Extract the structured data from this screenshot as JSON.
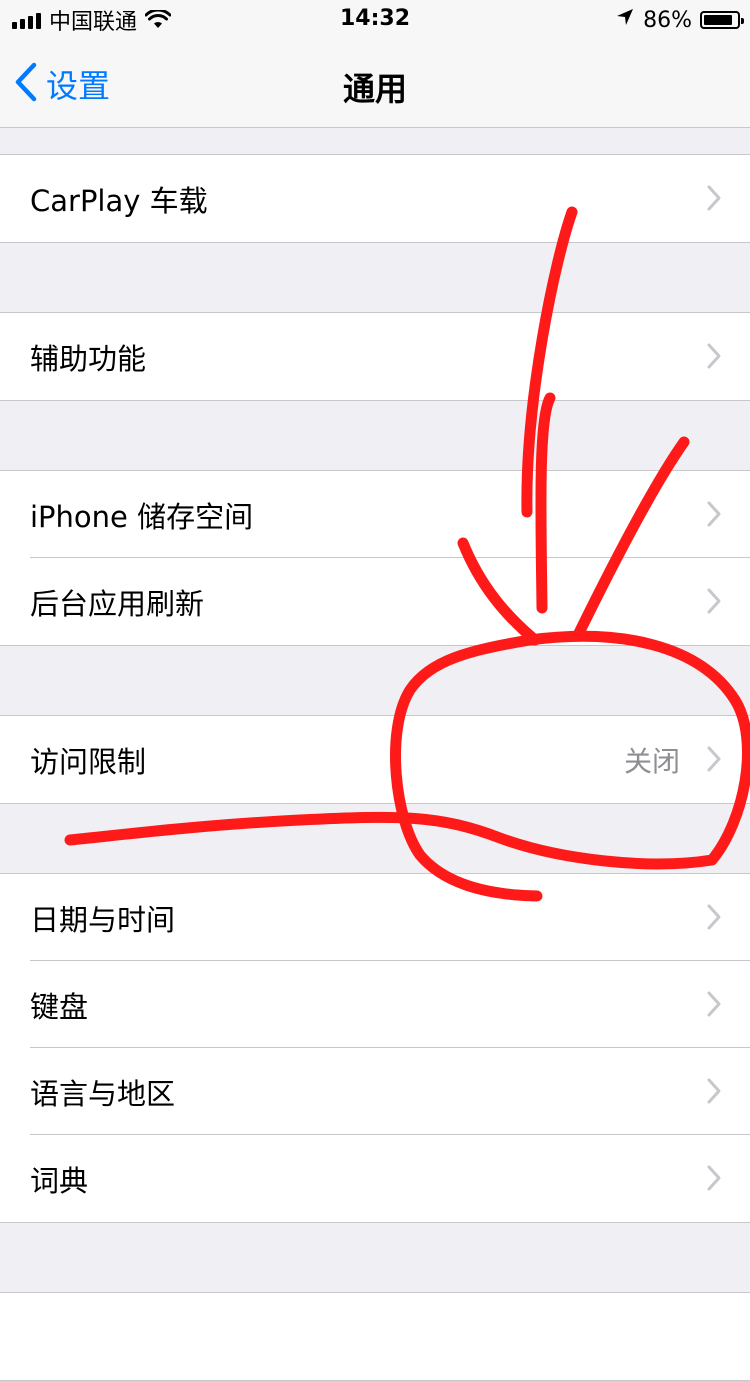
{
  "status_bar": {
    "carrier": "中国联通",
    "time": "14:32",
    "battery_percent": "86%",
    "battery_level": 0.86
  },
  "nav": {
    "back_label": "设置",
    "title": "通用"
  },
  "groups": [
    {
      "rows": [
        {
          "label": "CarPlay 车载"
        }
      ]
    },
    {
      "rows": [
        {
          "label": "辅助功能"
        }
      ]
    },
    {
      "rows": [
        {
          "label": "iPhone 储存空间"
        },
        {
          "label": "后台应用刷新"
        }
      ]
    },
    {
      "rows": [
        {
          "label": "访问限制",
          "value": "关闭"
        }
      ]
    },
    {
      "rows": [
        {
          "label": "日期与时间"
        },
        {
          "label": "键盘"
        },
        {
          "label": "语言与地区"
        },
        {
          "label": "词典"
        }
      ]
    }
  ],
  "colors": {
    "accent": "#007aff",
    "annotation": "#ff1a1a",
    "background": "#efeff4"
  },
  "icons": [
    "signal-icon",
    "wifi-icon",
    "location-arrow-icon",
    "battery-icon",
    "chevron-left-icon",
    "chevron-right-icon"
  ]
}
